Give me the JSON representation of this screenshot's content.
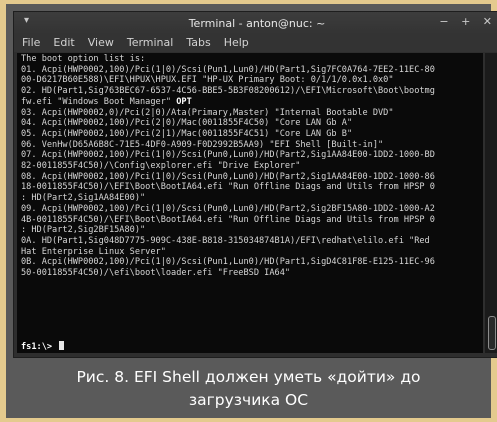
{
  "window": {
    "title": "Terminal - anton@nuc: ~",
    "menu_glyph": "▾",
    "controls": [
      "−",
      "+",
      "✕"
    ]
  },
  "menu": [
    "File",
    "Edit",
    "View",
    "Terminal",
    "Tabs",
    "Help"
  ],
  "terminal": {
    "lines": [
      {
        "text": "The boot option list is:"
      },
      {
        "text": "01. Acpi(HWP0002,100)/Pci(1|0)/Scsi(Pun1,Lun0)/HD(Part1,Sig7FC0A764-7EE2-11EC-80"
      },
      {
        "text": "00-D6217B60E588)\\EFI\\HPUX\\HPUX.EFI \"HP-UX Primary Boot: 0/1/1/0.0x1.0x0\""
      },
      {
        "text": "02. HD(Part1,Sig763BEC67-6537-4C56-BBE5-5B3F08200612)/\\EFI\\Microsoft\\Boot\\bootmg"
      },
      {
        "text": "fw.efi \"Windows Boot Manager\" ",
        "bold": "OPT"
      },
      {
        "text": "03. Acpi(HWP0002,0)/Pci(2|0)/Ata(Primary,Master) \"Internal Bootable DVD\""
      },
      {
        "text": "04. Acpi(HWP0002,100)/Pci(2|0)/Mac(0011855F4C50) \"Core LAN Gb A\""
      },
      {
        "text": "05. Acpi(HWP0002,100)/Pci(2|1)/Mac(0011855F4C51) \"Core LAN Gb B\""
      },
      {
        "text": "06. VenHw(D65A6B8C-71E5-4DF0-A909-F0D2992B5AA9) \"EFI Shell [Built-in]\""
      },
      {
        "text": "07. Acpi(HWP0002,100)/Pci(1|0)/Scsi(Pun0,Lun0)/HD(Part2,Sig1AA84E00-1DD2-1000-BD"
      },
      {
        "text": "82-0011855F4C50)/\\Config\\explorer.efi \"Drive Explorer\""
      },
      {
        "text": "08. Acpi(HWP0002,100)/Pci(1|0)/Scsi(Pun0,Lun0)/HD(Part2,Sig1AA84E00-1DD2-1000-86"
      },
      {
        "text": "18-0011855F4C50)/\\EFI\\Boot\\BootIA64.efi \"Run Offline Diags and Utils from HPSP 0"
      },
      {
        "text": ": HD(Part2,Sig1AA84E00)\""
      },
      {
        "text": "09. Acpi(HWP0002,100)/Pci(1|0)/Scsi(Pun0,Lun0)/HD(Part2,Sig2BF15A80-1DD2-1000-A2"
      },
      {
        "text": "4B-0011855F4C50)/\\EFI\\Boot\\BootIA64.efi \"Run Offline Diags and Utils from HPSP 0"
      },
      {
        "text": ": HD(Part2,Sig2BF15A80)\""
      },
      {
        "text": "0A. HD(Part1,Sig048D7775-909C-438E-B818-315034874B1A)/EFI\\redhat\\elilo.efi \"Red"
      },
      {
        "text": "Hat Enterprise Linux Server\""
      },
      {
        "text": "0B. Acpi(HWP0002,100)/Pci(1|0)/Scsi(Pun1,Lun0)/HD(Part1,SigD4C81F8E-E125-11EC-96"
      },
      {
        "text": "50-0011855F4C50)/\\efi\\boot\\loader.efi \"FreeBSD IA64\""
      }
    ],
    "prompt": "fs1:\\> "
  },
  "caption": {
    "line1": "Рис. 8. EFI Shell должен уметь «дойти» до",
    "line2": "загрузчика ОС"
  },
  "colors": {
    "page_background": "#e4ca8e",
    "frame": "#5a5a5a",
    "terminal_background": "#0a0a0a",
    "terminal_text": "#d6d6d6"
  }
}
